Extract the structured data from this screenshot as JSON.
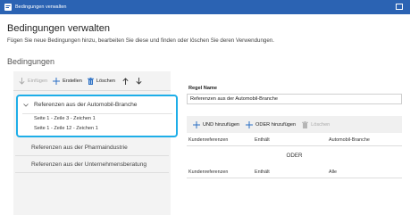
{
  "window": {
    "title": "Bedingungen verwalten"
  },
  "header": {
    "title": "Bedingungen verwalten",
    "subtitle": "Fügen Sie neue Bedingungen hinzu, bearbeiten Sie diese und finden oder löschen Sie deren Verwendungen."
  },
  "conditions": {
    "section_title": "Bedingungen",
    "toolbar": {
      "insert_label": "Einfügen",
      "create_label": "Erstellen",
      "delete_label": "Löschen"
    },
    "selected": {
      "label": "Referenzen aus der Automobil-Branche",
      "usages": [
        "Seite 1 - Zeile 3 - Zeichen 1",
        "Seite 1 - Zeile 12 - Zeichen 1"
      ]
    },
    "items": [
      {
        "label": "Referenzen aus der Pharmaindustrie"
      },
      {
        "label": "Referenzen aus der Unternehmensberatung"
      }
    ]
  },
  "rule": {
    "name_label": "Regel Name",
    "name_value": "Referenzen aus der Automobil-Branche",
    "toolbar": {
      "and_label": "UND hinzufügen",
      "or_label": "ODER hinzufügen",
      "delete_label": "Löschen"
    },
    "rows": [
      {
        "field": "Kundenreferenzen",
        "op": "Enthält",
        "value": "Automobil-Branche"
      },
      {
        "field": "Kundenreferenzen",
        "op": "Enthält",
        "value": "Alle"
      }
    ],
    "or_separator": "ODER"
  },
  "colors": {
    "titlebar": "#2b63b3",
    "selection_border": "#1eaee8",
    "accent_icon": "#2b6fc4",
    "disabled": "#a8a8a8"
  }
}
